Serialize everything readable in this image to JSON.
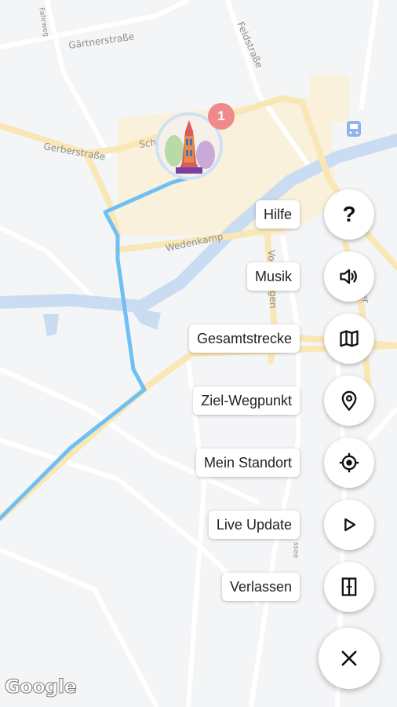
{
  "map": {
    "streets": [
      "Gärtnerstraße",
      "Gerberstraße",
      "Sch",
      "Wedenkamp",
      "Feldstraße",
      "Vo",
      "gen",
      "Fahrweg",
      "ssee",
      "ilner"
    ],
    "google_logo": "Google"
  },
  "marker": {
    "badge_count": "1"
  },
  "actions": [
    {
      "label": "Hilfe",
      "icon": "help-icon"
    },
    {
      "label": "Musik",
      "icon": "volume-icon"
    },
    {
      "label": "Gesamtstrecke",
      "icon": "map-icon"
    },
    {
      "label": "Ziel-Wegpunkt",
      "icon": "location-pin-icon"
    },
    {
      "label": "Mein Standort",
      "icon": "my-location-icon"
    },
    {
      "label": "Live Update",
      "icon": "play-icon"
    },
    {
      "label": "Verlassen",
      "icon": "exit-door-icon"
    }
  ],
  "close_button": {
    "icon": "close-icon"
  },
  "colors": {
    "route": "#6ec0f4",
    "badge": "#f08a8a",
    "water": "#c9dcf1",
    "road_major": "#f9e7b5"
  }
}
